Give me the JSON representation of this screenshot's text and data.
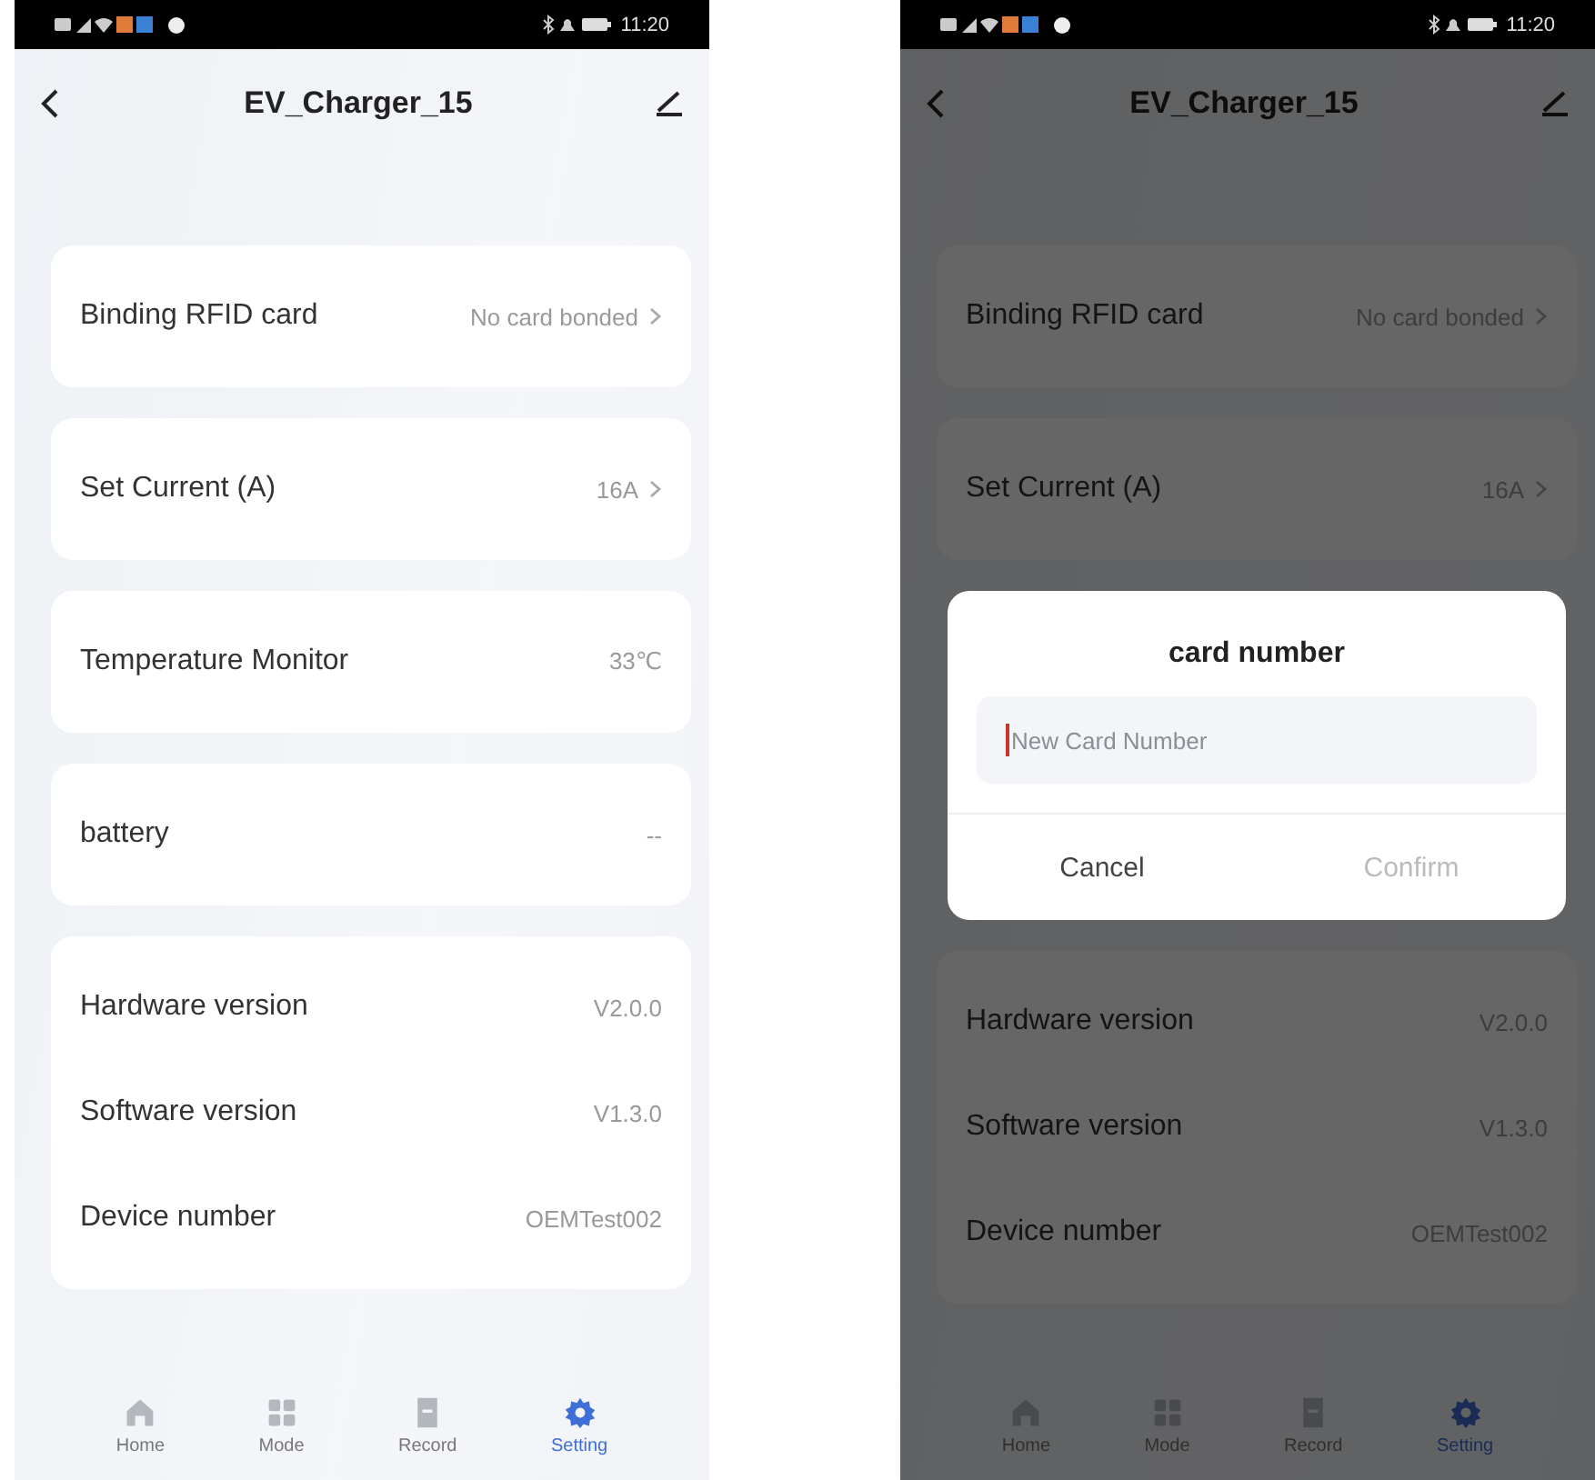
{
  "screens": [
    {
      "status_bar": {
        "time": "11:20"
      },
      "title": "EV_Charger_15",
      "cards": [
        {
          "rows": [
            {
              "label": "Binding RFID card",
              "value": "No card bonded",
              "chevron": true
            }
          ]
        },
        {
          "rows": [
            {
              "label": "Set Current (A)",
              "value": "16A",
              "chevron": true
            }
          ]
        },
        {
          "rows": [
            {
              "label": "Temperature Monitor",
              "value": "33℃",
              "chevron": false
            }
          ]
        },
        {
          "rows": [
            {
              "label": "battery",
              "value": "--",
              "chevron": false
            }
          ]
        },
        {
          "rows": [
            {
              "label": "Hardware version",
              "value": "V2.0.0",
              "chevron": false
            },
            {
              "label": "Software version",
              "value": "V1.3.0",
              "chevron": false
            },
            {
              "label": "Device number",
              "value": "OEMTest002",
              "chevron": false
            }
          ]
        }
      ],
      "tabs": [
        {
          "label": "Home",
          "selected": false
        },
        {
          "label": "Mode",
          "selected": false
        },
        {
          "label": "Record",
          "selected": false
        },
        {
          "label": "Setting",
          "selected": true
        }
      ]
    },
    {
      "status_bar": {
        "time": "11:20"
      },
      "title": "EV_Charger_15",
      "cards": [
        {
          "rows": [
            {
              "label": "Binding RFID card",
              "value": "No card bonded",
              "chevron": true
            }
          ]
        },
        {
          "rows": [
            {
              "label": "Set Current (A)",
              "value": "16A",
              "chevron": true
            }
          ]
        },
        {
          "rows": [
            {
              "label": "Hardware version",
              "value": "V2.0.0",
              "chevron": false
            },
            {
              "label": "Software version",
              "value": "V1.3.0",
              "chevron": false
            },
            {
              "label": "Device number",
              "value": "OEMTest002",
              "chevron": false
            }
          ]
        }
      ],
      "dialog": {
        "title": "card number",
        "field": {
          "placeholder": "New Card Number"
        },
        "buttons": [
          {
            "label": "Cancel",
            "disabled": false
          },
          {
            "label": "Confirm",
            "disabled": true
          }
        ]
      },
      "tabs": [
        {
          "label": "Home",
          "selected": false
        },
        {
          "label": "Mode",
          "selected": false
        },
        {
          "label": "Record",
          "selected": false
        },
        {
          "label": "Setting",
          "selected": true
        }
      ]
    }
  ]
}
